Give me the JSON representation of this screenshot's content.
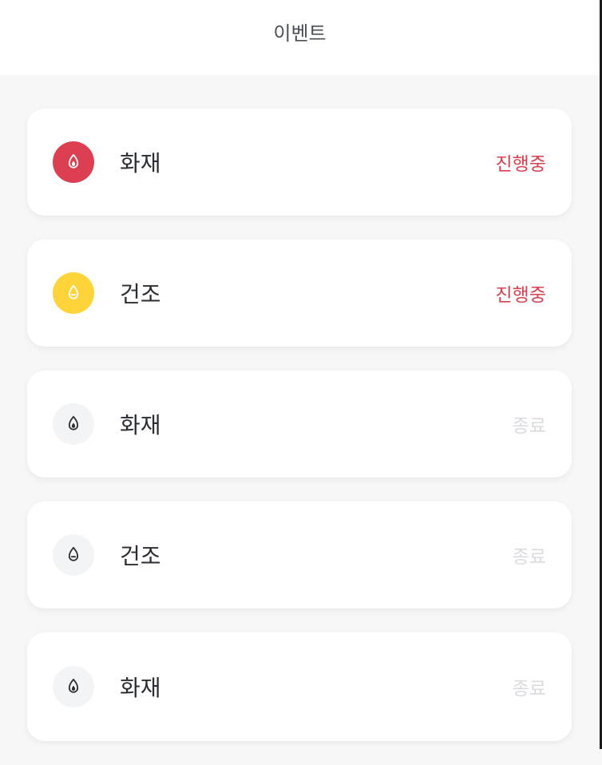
{
  "header": {
    "title": "이벤트"
  },
  "colors": {
    "active": "#d9404f",
    "ended": "#d8dbdf",
    "fire_bg": "#db3f51",
    "dry_bg": "#ffd43b",
    "inactive_bg": "#f3f4f5",
    "inactive_icon": "#2b2f35"
  },
  "events": [
    {
      "name": "화재",
      "status": "진행중",
      "icon": "fire-icon",
      "state": "active"
    },
    {
      "name": "건조",
      "status": "진행중",
      "icon": "dry-drop-icon",
      "state": "active"
    },
    {
      "name": "화재",
      "status": "종료",
      "icon": "fire-icon",
      "state": "ended"
    },
    {
      "name": "건조",
      "status": "종료",
      "icon": "dry-drop-icon",
      "state": "ended"
    },
    {
      "name": "화재",
      "status": "종료",
      "icon": "fire-icon",
      "state": "ended"
    }
  ]
}
